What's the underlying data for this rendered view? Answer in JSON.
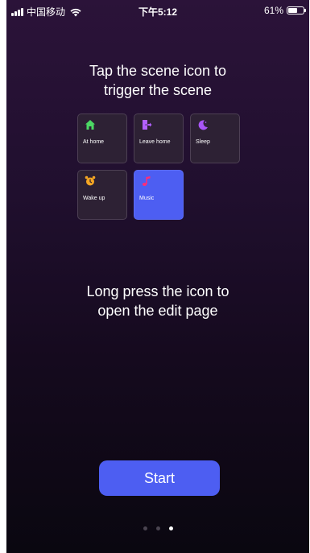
{
  "status_bar": {
    "carrier": "中国移动",
    "time": "下午5:12",
    "battery_text": "61%",
    "battery_level": 0.61
  },
  "instructions": {
    "tap_line1": "Tap the scene icon to",
    "tap_line2": "trigger the scene",
    "press_line1": "Long press the icon to",
    "press_line2": "open the edit page"
  },
  "scenes": [
    {
      "label": "At home",
      "icon": "house-icon",
      "color": "#4cd964",
      "active": false
    },
    {
      "label": "Leave home",
      "icon": "door-exit-icon",
      "color": "#b260ff",
      "active": false
    },
    {
      "label": "Sleep",
      "icon": "moon-icon",
      "color": "#a855f7",
      "active": false
    },
    {
      "label": "Wake up",
      "icon": "alarm-clock-icon",
      "color": "#f5a623",
      "active": false
    },
    {
      "label": "Music",
      "icon": "music-note-icon",
      "color": "#ff2d78",
      "active": true
    }
  ],
  "start_button": {
    "label": "Start"
  },
  "pager": {
    "total": 3,
    "current": 3
  }
}
